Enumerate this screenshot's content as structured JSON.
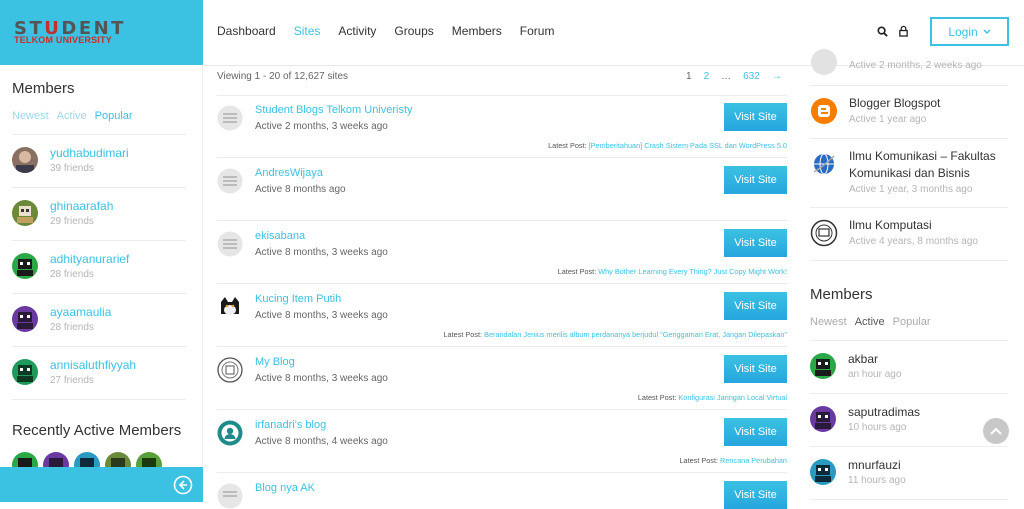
{
  "logo": {
    "line1a": "ST",
    "line1v": "U",
    "line1b": "DENT",
    "line2": "TELKOM UNIVERSITY"
  },
  "nav": [
    "Dashboard",
    "Sites",
    "Activity",
    "Groups",
    "Members",
    "Forum"
  ],
  "nav_active": "Sites",
  "login_label": "Login",
  "colors": {
    "accent": "#3bc1e2",
    "button": "#29abe2"
  },
  "left_sidebar": {
    "members_title": "Members",
    "filters": [
      "Newest",
      "Active",
      "Popular"
    ],
    "members": [
      {
        "name": "yudhabudimari",
        "sub": "39 friends"
      },
      {
        "name": "ghinaarafah",
        "sub": "29 friends"
      },
      {
        "name": "adhityanurarief",
        "sub": "28 friends"
      },
      {
        "name": "ayaamaulia",
        "sub": "28 friends"
      },
      {
        "name": "annisaluthfiyyah",
        "sub": "27 friends"
      }
    ],
    "recent_title": "Recently Active Members"
  },
  "main": {
    "viewing": "Viewing 1 - 20 of 12,627 sites",
    "pager": {
      "p1": "1",
      "p2": "2",
      "dots": "…",
      "last": "632",
      "next": "→"
    },
    "visit_label": "Visit Site",
    "latest_prefix": "Latest Post:",
    "sites": [
      {
        "name": "Student Blogs Telkom Univeristy",
        "active": "Active 2 months, 3 weeks ago",
        "latest": "[Pemberitahuan] Crash Sistem Pada SSL dan WordPress 5.0"
      },
      {
        "name": "AndresWijaya",
        "active": "Active 8 months ago",
        "latest": ""
      },
      {
        "name": "ekisabana",
        "active": "Active 8 months, 3 weeks ago",
        "latest": "Why Bother Learning Every Thing? Just Copy Might Work!"
      },
      {
        "name": "Kucing Item Putih",
        "active": "Active 8 months, 3 weeks ago",
        "latest": "Berandalan Jenius merilis album perdananya berjudul \"Genggaman Erat, Jangan Dilepaskan\""
      },
      {
        "name": "My Blog",
        "active": "Active 8 months, 3 weeks ago",
        "latest": "Konfigurasi Jaringan Local Virtual"
      },
      {
        "name": "irfanadri's blog",
        "active": "Active 8 months, 4 weeks ago",
        "latest": "Rencana Perubahan"
      },
      {
        "name": "Blog nya AK",
        "active": "",
        "latest": ""
      }
    ]
  },
  "right_sidebar": {
    "blogs": [
      {
        "name": "",
        "sub": "Active 2 months, 2 weeks ago",
        "icon": "gray-circle-icon"
      },
      {
        "name": "Blogger Blogspot",
        "sub": "Active 1 year ago",
        "icon": "blogger-icon"
      },
      {
        "name": "Ilmu Komunikasi – Fakultas Komunikasi dan Bisnis",
        "sub": "Active 1 year, 3 months ago",
        "icon": "globe-icon"
      },
      {
        "name": "Ilmu Komputasi",
        "sub": "Active 4 years, 8 months ago",
        "icon": "computer-icon"
      }
    ],
    "members_title": "Members",
    "filters": [
      "Newest",
      "Active",
      "Popular"
    ],
    "members": [
      {
        "name": "akbar",
        "sub": "an hour ago"
      },
      {
        "name": "saputradimas",
        "sub": "10 hours ago"
      },
      {
        "name": "mnurfauzi",
        "sub": "11 hours ago"
      }
    ]
  }
}
